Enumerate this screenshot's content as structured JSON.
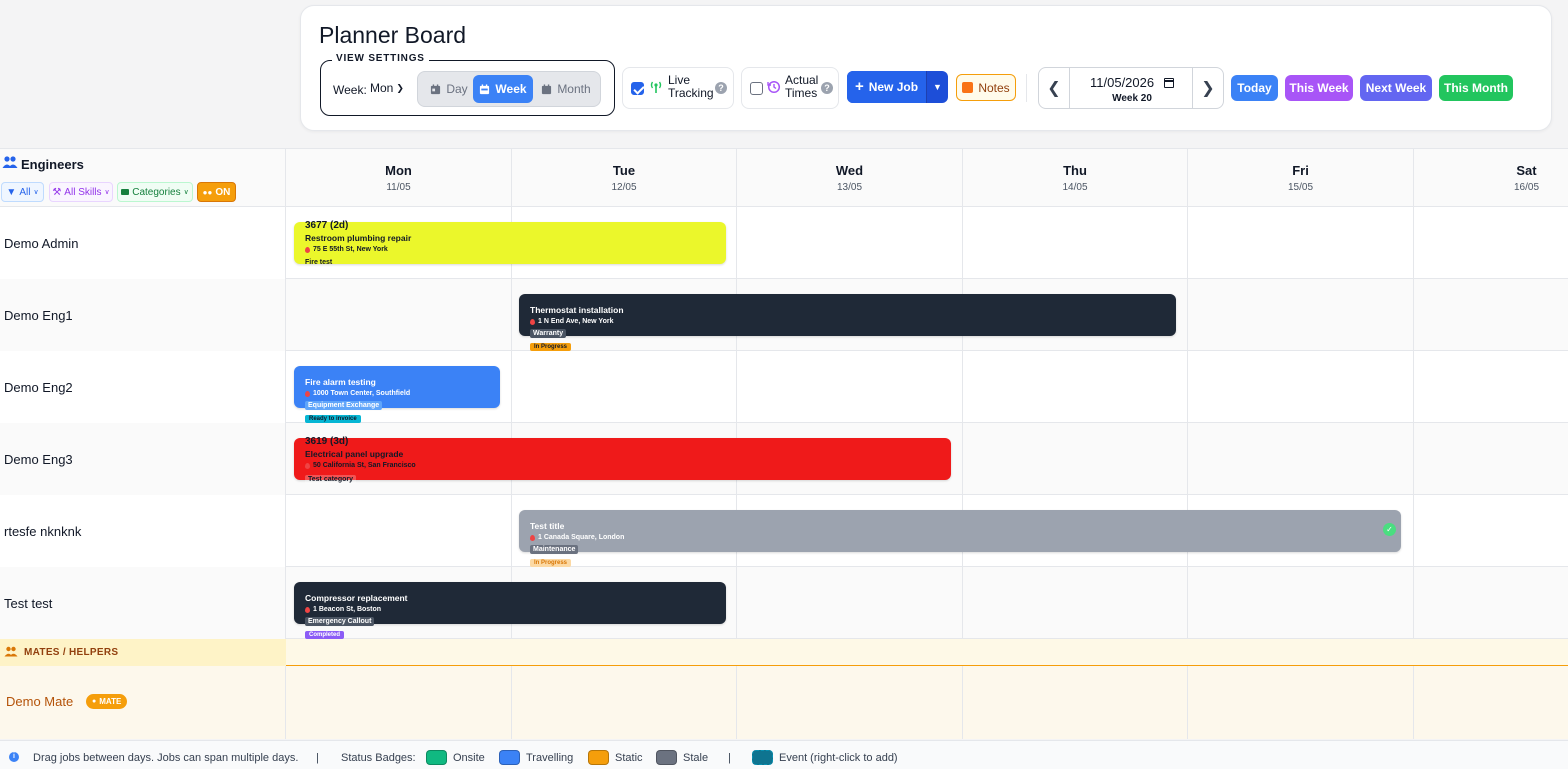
{
  "header": {
    "title": "Planner Board",
    "view_settings_label": "VIEW SETTINGS",
    "week_label": "Week:",
    "week_start": "Mon",
    "views": [
      "Day",
      "Week",
      "Month"
    ],
    "live_tracking": "Live Tracking",
    "live_tracking_checked": true,
    "actual_times": "Actual Times",
    "actual_times_checked": false,
    "help_glyph": "?",
    "new_job": "New Job",
    "notes": "Notes",
    "date_value": "11/05/2026",
    "week_number": "Week 20",
    "quick_today": "Today",
    "quick_this_week": "This Week",
    "quick_next_week": "Next Week",
    "quick_this_month": "This Month"
  },
  "engineers_panel": {
    "title": "Engineers",
    "filter_all": "All",
    "filter_skills": "All Skills",
    "filter_categories": "Categories",
    "toggle_on": "ON"
  },
  "days": [
    {
      "name": "Mon",
      "date": "11/05"
    },
    {
      "name": "Tue",
      "date": "12/05"
    },
    {
      "name": "Wed",
      "date": "13/05"
    },
    {
      "name": "Thu",
      "date": "14/05"
    },
    {
      "name": "Fri",
      "date": "15/05"
    },
    {
      "name": "Sat",
      "date": "16/05"
    }
  ],
  "engineers": [
    {
      "name": "Demo Admin"
    },
    {
      "name": "Demo Eng1"
    },
    {
      "name": "Demo Eng2"
    },
    {
      "name": "Demo Eng3"
    },
    {
      "name": "rtesfe nknknk"
    },
    {
      "name": "Test test"
    }
  ],
  "jobs": [
    {
      "id": "3677 (2d)",
      "title": "Restroom plumbing repair",
      "address": "75 E 55th St, New York",
      "tag": "Fire test",
      "status": "",
      "color": "#ebf72b",
      "text_color": "#111827"
    },
    {
      "id": "",
      "title": "Thermostat installation",
      "address": "1 N End Ave, New York",
      "tag": "Warranty",
      "status": "In Progress",
      "color": "#1f2937",
      "text_color": "#ffffff"
    },
    {
      "id": "",
      "title": "Fire alarm testing",
      "address": "1000 Town Center, Southfield",
      "tag": "Equipment Exchange",
      "status": "Ready to invoice",
      "color": "#3b82f6",
      "text_color": "#ffffff"
    },
    {
      "id": "3619 (3d)",
      "title": "Electrical panel upgrade",
      "address": "50 California St, San Francisco",
      "tag": "Test category",
      "status": "",
      "color": "#ef1a1a",
      "text_color": "#111827"
    },
    {
      "id": "",
      "title": "Test title",
      "address": "1 Canada Square, London",
      "tag": "Maintenance",
      "status": "In Progress",
      "color": "#9ca3af",
      "text_color": "#ffffff",
      "done_glyph": "✓"
    },
    {
      "id": "",
      "title": "Compressor replacement",
      "address": "1 Beacon St, Boston",
      "tag": "Emergency Callout",
      "status": "Completed",
      "color": "#1f2937",
      "text_color": "#ffffff"
    }
  ],
  "mates": {
    "title": "MATES / HELPERS",
    "rows": [
      {
        "name": "Demo Mate",
        "badge": "MATE"
      }
    ]
  },
  "footer": {
    "info_glyph": "i",
    "hint": "Drag jobs between days. Jobs can span multiple days.",
    "separator": "|",
    "status_label": "Status Badges:",
    "badges": [
      {
        "label": "Onsite",
        "color": "#10b981"
      },
      {
        "label": "Travelling",
        "color": "#3b82f6"
      },
      {
        "label": "Static",
        "color": "#f59e0b"
      },
      {
        "label": "Stale",
        "color": "#6b7280"
      }
    ],
    "event_label": "Event (right-click to add)",
    "event_color": "#0e7490"
  },
  "icons": [
    "people-icon",
    "calendar-day-icon",
    "calendar-week-icon",
    "calendar-month-icon",
    "antenna-icon",
    "history-icon",
    "plus-icon",
    "note-icon",
    "chevron-left-icon",
    "chevron-right-icon",
    "filter-icon",
    "wrench-icon",
    "folder-icon",
    "pin-icon",
    "check-icon",
    "info-icon"
  ]
}
